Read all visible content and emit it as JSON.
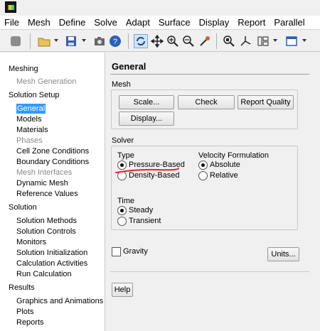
{
  "menubar": {
    "items": [
      "File",
      "Mesh",
      "Define",
      "Solve",
      "Adapt",
      "Surface",
      "Display",
      "Report",
      "Parallel"
    ]
  },
  "toolbar": {
    "icons": [
      "stop-icon",
      "open-folder-icon",
      "save-icon",
      "camera-icon",
      "help-icon",
      "rotate-icon",
      "move-icon",
      "zoom-in-icon",
      "zoom-box-icon",
      "probe-icon",
      "zoom-fit-icon",
      "axes-icon",
      "layout-icon",
      "window-icon"
    ]
  },
  "tree": {
    "meshing": "Meshing",
    "mesh_generation": "Mesh Generation",
    "solution_setup": "Solution Setup",
    "general": "General",
    "models": "Models",
    "materials": "Materials",
    "phases": "Phases",
    "cell_zone_conditions": "Cell Zone Conditions",
    "boundary_conditions": "Boundary Conditions",
    "mesh_interfaces": "Mesh Interfaces",
    "dynamic_mesh": "Dynamic Mesh",
    "reference_values": "Reference Values",
    "solution": "Solution",
    "solution_methods": "Solution Methods",
    "solution_controls": "Solution Controls",
    "monitors": "Monitors",
    "solution_initialization": "Solution Initialization",
    "calculation_activities": "Calculation Activities",
    "run_calculation": "Run Calculation",
    "results": "Results",
    "graphics_and_animations": "Graphics and Animations",
    "plots": "Plots",
    "reports": "Reports"
  },
  "panel": {
    "title": "General",
    "mesh_group": "Mesh",
    "scale_button": "Scale...",
    "check_button": "Check",
    "report_quality_button": "Report Quality",
    "display_button": "Display...",
    "solver_group": "Solver",
    "type_label": "Type",
    "pressure_based": "Pressure-Based",
    "density_based": "Density-Based",
    "velocity_label": "Velocity Formulation",
    "absolute": "Absolute",
    "relative": "Relative",
    "time_label": "Time",
    "steady": "Steady",
    "transient": "Transient",
    "gravity": "Gravity",
    "units_button": "Units...",
    "help_button": "Help"
  },
  "colors": {
    "selection": "#3399ff",
    "annotation": "#e8202a"
  }
}
